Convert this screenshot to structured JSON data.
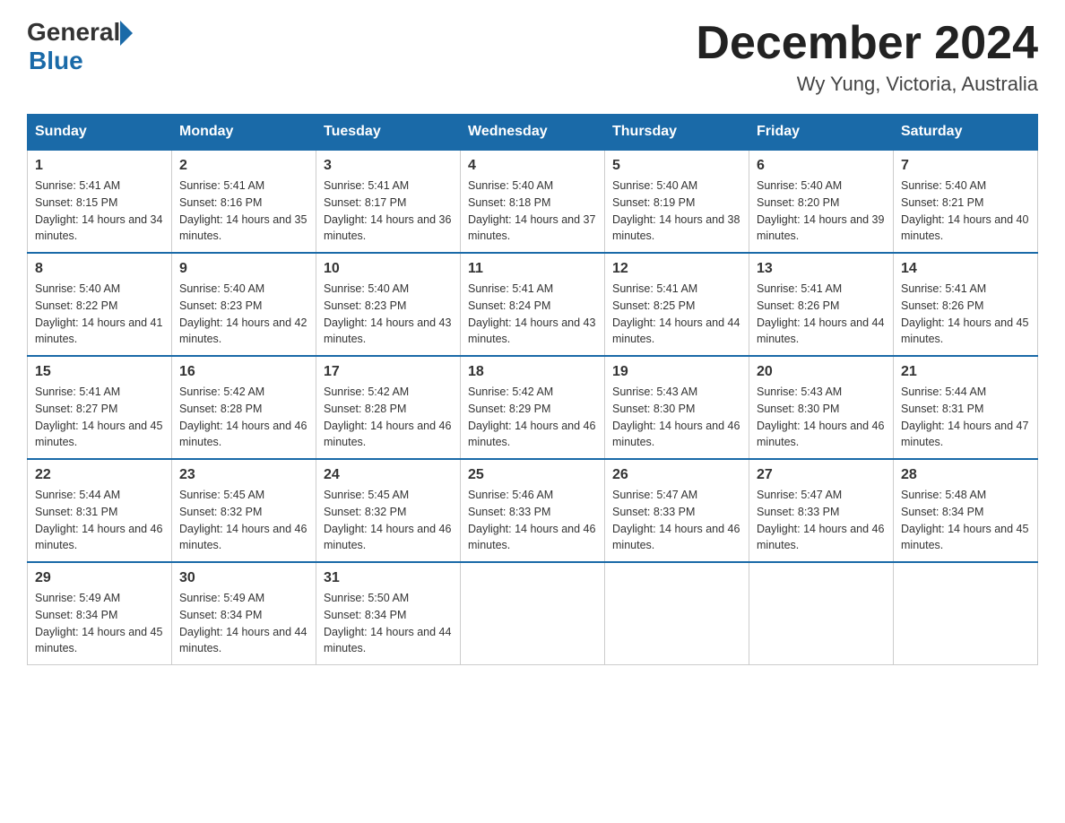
{
  "logo": {
    "general": "General",
    "blue": "Blue"
  },
  "title": "December 2024",
  "subtitle": "Wy Yung, Victoria, Australia",
  "headers": [
    "Sunday",
    "Monday",
    "Tuesday",
    "Wednesday",
    "Thursday",
    "Friday",
    "Saturday"
  ],
  "weeks": [
    [
      {
        "day": "1",
        "sunrise": "5:41 AM",
        "sunset": "8:15 PM",
        "daylight": "14 hours and 34 minutes."
      },
      {
        "day": "2",
        "sunrise": "5:41 AM",
        "sunset": "8:16 PM",
        "daylight": "14 hours and 35 minutes."
      },
      {
        "day": "3",
        "sunrise": "5:41 AM",
        "sunset": "8:17 PM",
        "daylight": "14 hours and 36 minutes."
      },
      {
        "day": "4",
        "sunrise": "5:40 AM",
        "sunset": "8:18 PM",
        "daylight": "14 hours and 37 minutes."
      },
      {
        "day": "5",
        "sunrise": "5:40 AM",
        "sunset": "8:19 PM",
        "daylight": "14 hours and 38 minutes."
      },
      {
        "day": "6",
        "sunrise": "5:40 AM",
        "sunset": "8:20 PM",
        "daylight": "14 hours and 39 minutes."
      },
      {
        "day": "7",
        "sunrise": "5:40 AM",
        "sunset": "8:21 PM",
        "daylight": "14 hours and 40 minutes."
      }
    ],
    [
      {
        "day": "8",
        "sunrise": "5:40 AM",
        "sunset": "8:22 PM",
        "daylight": "14 hours and 41 minutes."
      },
      {
        "day": "9",
        "sunrise": "5:40 AM",
        "sunset": "8:23 PM",
        "daylight": "14 hours and 42 minutes."
      },
      {
        "day": "10",
        "sunrise": "5:40 AM",
        "sunset": "8:23 PM",
        "daylight": "14 hours and 43 minutes."
      },
      {
        "day": "11",
        "sunrise": "5:41 AM",
        "sunset": "8:24 PM",
        "daylight": "14 hours and 43 minutes."
      },
      {
        "day": "12",
        "sunrise": "5:41 AM",
        "sunset": "8:25 PM",
        "daylight": "14 hours and 44 minutes."
      },
      {
        "day": "13",
        "sunrise": "5:41 AM",
        "sunset": "8:26 PM",
        "daylight": "14 hours and 44 minutes."
      },
      {
        "day": "14",
        "sunrise": "5:41 AM",
        "sunset": "8:26 PM",
        "daylight": "14 hours and 45 minutes."
      }
    ],
    [
      {
        "day": "15",
        "sunrise": "5:41 AM",
        "sunset": "8:27 PM",
        "daylight": "14 hours and 45 minutes."
      },
      {
        "day": "16",
        "sunrise": "5:42 AM",
        "sunset": "8:28 PM",
        "daylight": "14 hours and 46 minutes."
      },
      {
        "day": "17",
        "sunrise": "5:42 AM",
        "sunset": "8:28 PM",
        "daylight": "14 hours and 46 minutes."
      },
      {
        "day": "18",
        "sunrise": "5:42 AM",
        "sunset": "8:29 PM",
        "daylight": "14 hours and 46 minutes."
      },
      {
        "day": "19",
        "sunrise": "5:43 AM",
        "sunset": "8:30 PM",
        "daylight": "14 hours and 46 minutes."
      },
      {
        "day": "20",
        "sunrise": "5:43 AM",
        "sunset": "8:30 PM",
        "daylight": "14 hours and 46 minutes."
      },
      {
        "day": "21",
        "sunrise": "5:44 AM",
        "sunset": "8:31 PM",
        "daylight": "14 hours and 47 minutes."
      }
    ],
    [
      {
        "day": "22",
        "sunrise": "5:44 AM",
        "sunset": "8:31 PM",
        "daylight": "14 hours and 46 minutes."
      },
      {
        "day": "23",
        "sunrise": "5:45 AM",
        "sunset": "8:32 PM",
        "daylight": "14 hours and 46 minutes."
      },
      {
        "day": "24",
        "sunrise": "5:45 AM",
        "sunset": "8:32 PM",
        "daylight": "14 hours and 46 minutes."
      },
      {
        "day": "25",
        "sunrise": "5:46 AM",
        "sunset": "8:33 PM",
        "daylight": "14 hours and 46 minutes."
      },
      {
        "day": "26",
        "sunrise": "5:47 AM",
        "sunset": "8:33 PM",
        "daylight": "14 hours and 46 minutes."
      },
      {
        "day": "27",
        "sunrise": "5:47 AM",
        "sunset": "8:33 PM",
        "daylight": "14 hours and 46 minutes."
      },
      {
        "day": "28",
        "sunrise": "5:48 AM",
        "sunset": "8:34 PM",
        "daylight": "14 hours and 45 minutes."
      }
    ],
    [
      {
        "day": "29",
        "sunrise": "5:49 AM",
        "sunset": "8:34 PM",
        "daylight": "14 hours and 45 minutes."
      },
      {
        "day": "30",
        "sunrise": "5:49 AM",
        "sunset": "8:34 PM",
        "daylight": "14 hours and 44 minutes."
      },
      {
        "day": "31",
        "sunrise": "5:50 AM",
        "sunset": "8:34 PM",
        "daylight": "14 hours and 44 minutes."
      },
      null,
      null,
      null,
      null
    ]
  ]
}
